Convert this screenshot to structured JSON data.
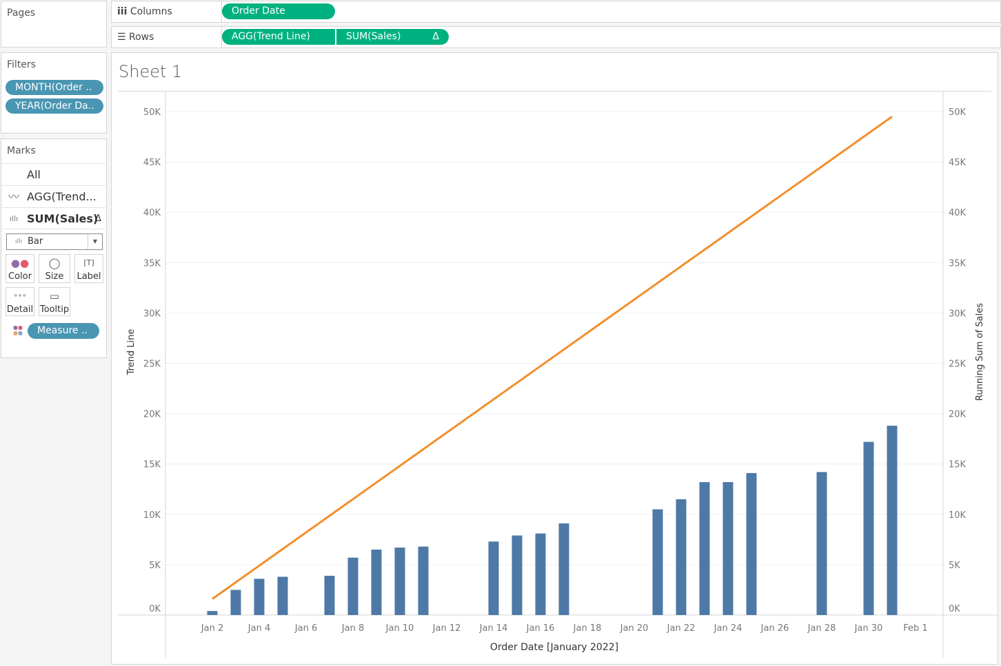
{
  "pages": {
    "title": "Pages"
  },
  "columns": {
    "label": "Columns",
    "pills": [
      "Order Date"
    ]
  },
  "rows": {
    "label": "Rows",
    "pills": [
      "AGG(Trend Line)",
      "SUM(Sales)"
    ],
    "delta": "Δ"
  },
  "filters": {
    "title": "Filters",
    "pills": [
      "MONTH(Order ..",
      "YEAR(Order Da.."
    ]
  },
  "marks": {
    "title": "Marks",
    "items": [
      "All",
      "AGG(Trend...",
      "SUM(Sales)"
    ],
    "delta": "Δ",
    "type": "Bar",
    "buttons": [
      "Color",
      "Size",
      "Label",
      "Detail",
      "Tooltip"
    ],
    "color_pill": "Measure .."
  },
  "sheet": {
    "title": "Sheet 1"
  },
  "chart_data": {
    "type": "bar+line",
    "xlabel": "Order Date [January 2022]",
    "ylabel_left": "Trend Line",
    "ylabel_right": "Running Sum of Sales",
    "ylim": [
      0,
      50000
    ],
    "yticks": [
      "0K",
      "5K",
      "10K",
      "15K",
      "20K",
      "25K",
      "30K",
      "35K",
      "40K",
      "45K",
      "50K"
    ],
    "xticks": [
      "Jan 2",
      "Jan 4",
      "Jan 6",
      "Jan 8",
      "Jan 10",
      "Jan 12",
      "Jan 14",
      "Jan 16",
      "Jan 18",
      "Jan 20",
      "Jan 22",
      "Jan 24",
      "Jan 26",
      "Jan 28",
      "Jan 30",
      "Feb 1"
    ],
    "bar_series": {
      "name": "Running Sum of Sales",
      "color": "#4e79a7",
      "days": [
        2,
        3,
        4,
        5,
        7,
        8,
        9,
        10,
        11,
        14,
        15,
        16,
        17,
        21,
        22,
        23,
        24,
        25,
        28,
        30,
        31
      ],
      "values": [
        400,
        2500,
        3600,
        3800,
        3900,
        5700,
        6500,
        6700,
        6800,
        7300,
        7900,
        8100,
        9100,
        10500,
        11500,
        13200,
        13200,
        14100,
        14200,
        17200,
        18800
      ]
    },
    "line_series": {
      "name": "Trend Line",
      "color": "#f28e2b",
      "days": [
        2,
        31
      ],
      "values": [
        1600,
        49500
      ]
    }
  }
}
